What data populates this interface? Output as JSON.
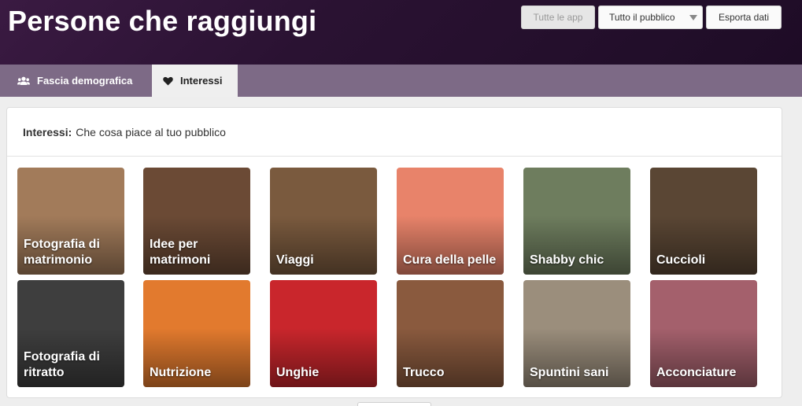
{
  "header": {
    "title": "Persone che raggiungi",
    "buttons": {
      "all_apps": "Tutte le app",
      "audience": "Tutto il pubblico",
      "export": "Esporta dati"
    }
  },
  "tabs": [
    {
      "label": "Fascia demografica",
      "icon": "users-icon",
      "active": false
    },
    {
      "label": "Interessi",
      "icon": "heart-icon",
      "active": true
    }
  ],
  "section": {
    "title": "Interessi:",
    "subtitle": "Che cosa piace al tuo pubblico"
  },
  "interests": [
    {
      "label": "Fotografia di matrimonio",
      "color": "#a27b5a"
    },
    {
      "label": "Idee per matrimoni",
      "color": "#6b4a35"
    },
    {
      "label": "Viaggi",
      "color": "#7a5a3e"
    },
    {
      "label": "Cura della pelle",
      "color": "#e8836a"
    },
    {
      "label": "Shabby chic",
      "color": "#6e7d5e"
    },
    {
      "label": "Cuccioli",
      "color": "#5a4634"
    },
    {
      "label": "Fotografia di ritratto",
      "color": "#3e3e3e"
    },
    {
      "label": "Nutrizione",
      "color": "#e27a2e"
    },
    {
      "label": "Unghie",
      "color": "#c9262c"
    },
    {
      "label": "Trucco",
      "color": "#8a5a3e"
    },
    {
      "label": "Spuntini sani",
      "color": "#9b8e7c"
    },
    {
      "label": "Acconciature",
      "color": "#a4606c"
    }
  ]
}
